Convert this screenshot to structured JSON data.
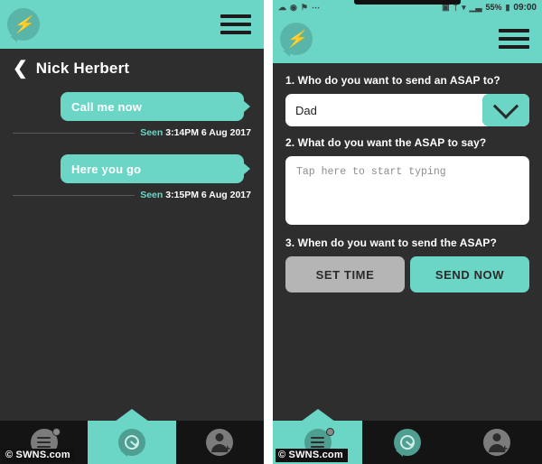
{
  "theme": {
    "accent_teal": "#6bd6c6",
    "accent_teal_dark": "#4f9e92",
    "screen_dark": "#2e2e2e",
    "nav_dark": "#141414",
    "button_grey": "#b5b5b5"
  },
  "left_phone": {
    "header": {
      "logo_icon": "speech-bubble-lightning-logo",
      "menu_icon": "hamburger-menu-icon"
    },
    "conversation": {
      "back_icon": "back-chevron-icon",
      "contact_name": "Nick Herbert",
      "messages": [
        {
          "text": "Call me now",
          "seen_label": "Seen",
          "seen_time": "3:14PM 6 Aug 2017"
        },
        {
          "text": "Here you go",
          "seen_label": "Seen",
          "seen_time": "3:15PM 6 Aug 2017"
        }
      ]
    },
    "bottom_nav": [
      {
        "icon": "inbox-list-icon",
        "active": false
      },
      {
        "icon": "chat-clock-icon",
        "active": true
      },
      {
        "icon": "add-contact-icon",
        "active": false
      }
    ]
  },
  "right_phone": {
    "status_bar": {
      "left_icons": [
        "cloud-icon",
        "record-circle-icon",
        "flag-icon",
        "more-dots-icon"
      ],
      "right_icons": [
        "sim-icon",
        "bluetooth-icon",
        "wifi-icon",
        "signal-icon"
      ],
      "battery_percent": "55%",
      "battery_icon": "battery-icon",
      "time": "09:00"
    },
    "header": {
      "logo_icon": "speech-bubble-lightning-logo",
      "menu_icon": "hamburger-menu-icon"
    },
    "form": {
      "question_one": "1. Who do you want to send an ASAP to?",
      "recipient_value": "Dad",
      "recipient_dropdown_icon": "chevron-down-icon",
      "question_two": "2. What do you want the ASAP to say?",
      "message_placeholder": "Tap here to start typing",
      "message_value": "",
      "question_three": "3. When do you want to send the ASAP?",
      "set_time_label": "SET TIME",
      "send_now_label": "SEND NOW"
    },
    "bottom_nav": [
      {
        "icon": "inbox-list-icon",
        "active": true
      },
      {
        "icon": "chat-clock-icon",
        "active": false
      },
      {
        "icon": "add-contact-icon",
        "active": false
      }
    ]
  },
  "watermark": "© SWNS.com"
}
